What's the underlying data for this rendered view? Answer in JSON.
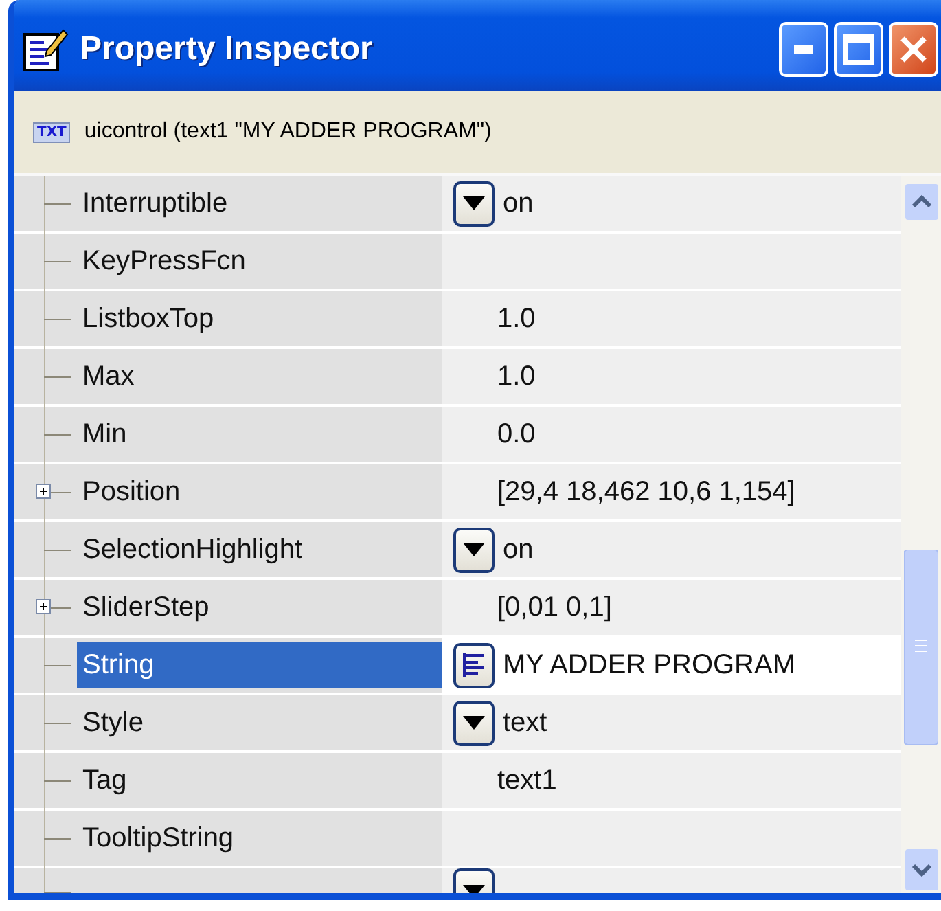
{
  "window": {
    "title": "Property Inspector"
  },
  "object_label": {
    "badge": "TXT",
    "text": "uicontrol (text1 \"MY ADDER PROGRAM\")"
  },
  "properties": [
    {
      "name": "Interruptible",
      "kind": "dropdown",
      "value": "on",
      "expandable": false,
      "selected": false
    },
    {
      "name": "KeyPressFcn",
      "kind": "text",
      "expandable": false,
      "selected": false
    },
    {
      "name": "ListboxTop",
      "kind": "text",
      "value": "1.0",
      "expandable": false,
      "selected": false
    },
    {
      "name": "Max",
      "kind": "text",
      "value": "1.0",
      "expandable": false,
      "selected": false
    },
    {
      "name": "Min",
      "kind": "text",
      "value": "0.0",
      "expandable": false,
      "selected": false
    },
    {
      "name": "Position",
      "kind": "text",
      "value": "[29,4 18,462 10,6 1,154]",
      "expandable": true,
      "selected": false
    },
    {
      "name": "SelectionHighlight",
      "kind": "dropdown",
      "value": "on",
      "expandable": false,
      "selected": false
    },
    {
      "name": "SliderStep",
      "kind": "text",
      "value": "[0,01 0,1]",
      "expandable": true,
      "selected": false
    },
    {
      "name": "String",
      "kind": "edit",
      "value": "MY ADDER PROGRAM",
      "expandable": false,
      "selected": true
    },
    {
      "name": "Style",
      "kind": "dropdown",
      "value": "text",
      "expandable": false,
      "selected": false
    },
    {
      "name": "Tag",
      "kind": "text",
      "value": "text1",
      "expandable": false,
      "selected": false
    },
    {
      "name": "TooltipString",
      "kind": "text",
      "expandable": false,
      "selected": false
    },
    {
      "kind": "dropdown"
    }
  ]
}
